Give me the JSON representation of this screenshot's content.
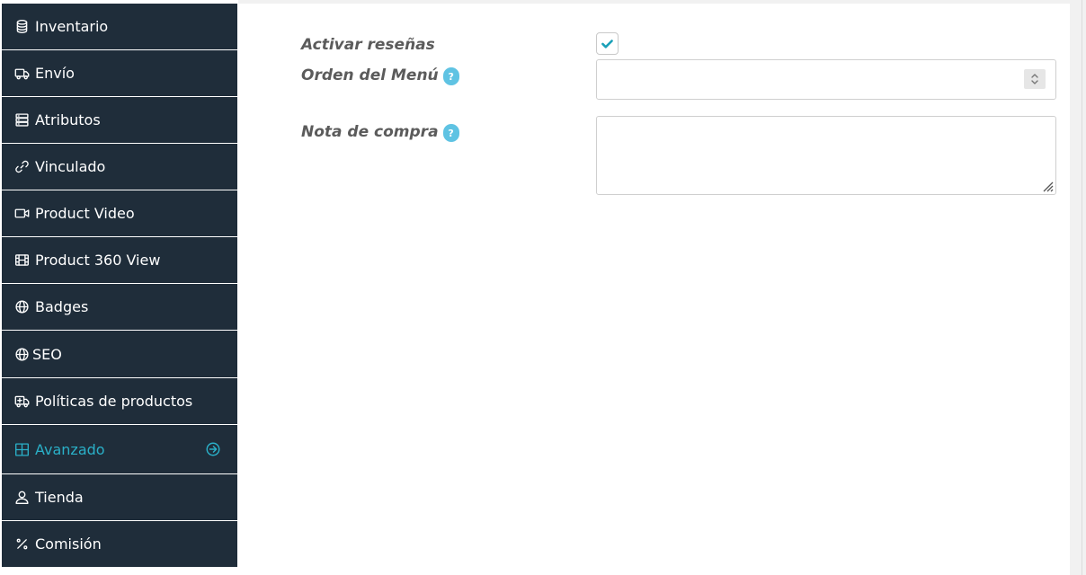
{
  "sidebar": {
    "items": [
      {
        "label": "Inventario",
        "icon": "database-icon"
      },
      {
        "label": "Envío",
        "icon": "truck-icon"
      },
      {
        "label": "Atributos",
        "icon": "server-icon"
      },
      {
        "label": "Vinculado",
        "icon": "link-icon"
      },
      {
        "label": "Product Video",
        "icon": "video-icon"
      },
      {
        "label": "Product 360 View",
        "icon": "film-icon"
      },
      {
        "label": "Badges",
        "icon": "globe-icon"
      },
      {
        "label": "SEO",
        "icon": "globe-icon"
      },
      {
        "label": "Políticas de productos",
        "icon": "medical-truck-icon"
      },
      {
        "label": "Avanzado",
        "icon": "grid-icon",
        "active": true
      },
      {
        "label": "Tienda",
        "icon": "user-icon"
      },
      {
        "label": "Comisión",
        "icon": "percent-icon"
      }
    ]
  },
  "form": {
    "reviews_label": "Activar reseñas",
    "reviews_checked": true,
    "menu_order_label": "Orden del Menú",
    "menu_order_value": "",
    "purchase_note_label": "Nota de compra",
    "purchase_note_value": "",
    "help_glyph": "?"
  },
  "colors": {
    "sidebar_bg": "#1f2d3a",
    "accent": "#2ab0c8",
    "help_badge": "#5fc3e3",
    "label_text": "#5b5b5b"
  }
}
